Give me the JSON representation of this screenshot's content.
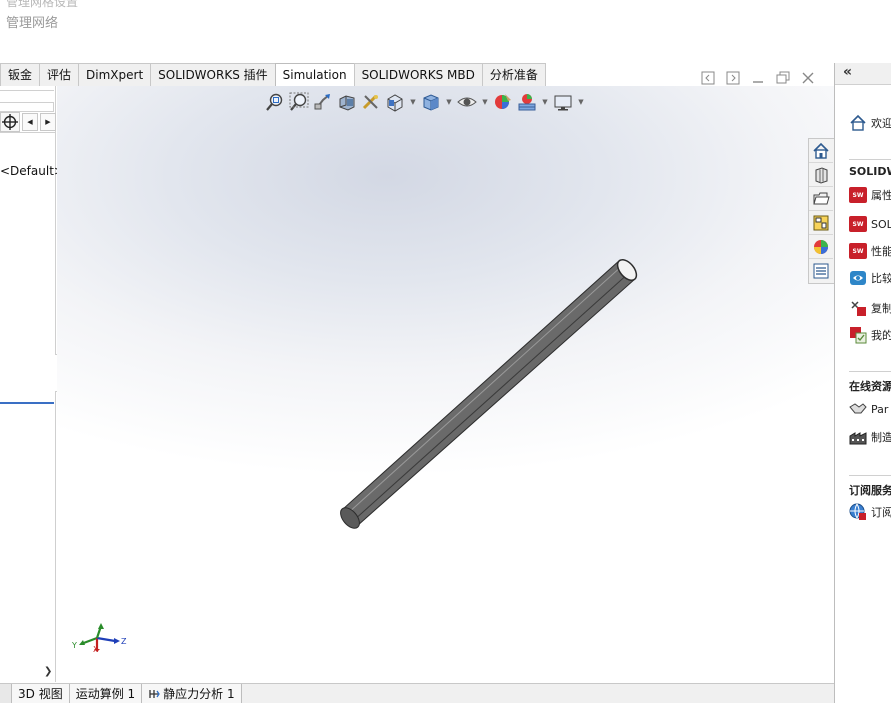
{
  "header": {
    "faint_text": "管理网格设置",
    "network_label": "管理网络"
  },
  "command_tabs": [
    {
      "label": "钣金"
    },
    {
      "label": "评估"
    },
    {
      "label": "DimXpert"
    },
    {
      "label": "SOLIDWORKS 插件"
    },
    {
      "label": "Simulation",
      "active": true
    },
    {
      "label": "SOLIDWORKS MBD"
    },
    {
      "label": "分析准备"
    }
  ],
  "feature_tree": {
    "config_text": "<Default>_"
  },
  "bottom_tabs": [
    {
      "label": "3D 视图"
    },
    {
      "label": "运动算例 1"
    },
    {
      "label": "静应力分析 1"
    }
  ],
  "triad": {
    "x": "X",
    "y": "Y",
    "z": "Z"
  },
  "task_pane": {
    "welcome": "欢迎",
    "section_solidworks": "SOLIDW",
    "items": [
      {
        "label": "属性",
        "badge": "SW"
      },
      {
        "label": "SOL",
        "badge": "SW"
      },
      {
        "label": "性能",
        "badge": "SW"
      },
      {
        "label": "比较",
        "badge": "cmp"
      },
      {
        "label": "复制",
        "badge": "SW"
      },
      {
        "label": "我的",
        "badge": "SW"
      }
    ],
    "section_online": "在线资源",
    "online_items": [
      {
        "label": "Par"
      },
      {
        "label": "制造"
      }
    ],
    "section_subscribe": "订阅服务",
    "subscribe_items": [
      {
        "label": "订阅"
      }
    ]
  }
}
